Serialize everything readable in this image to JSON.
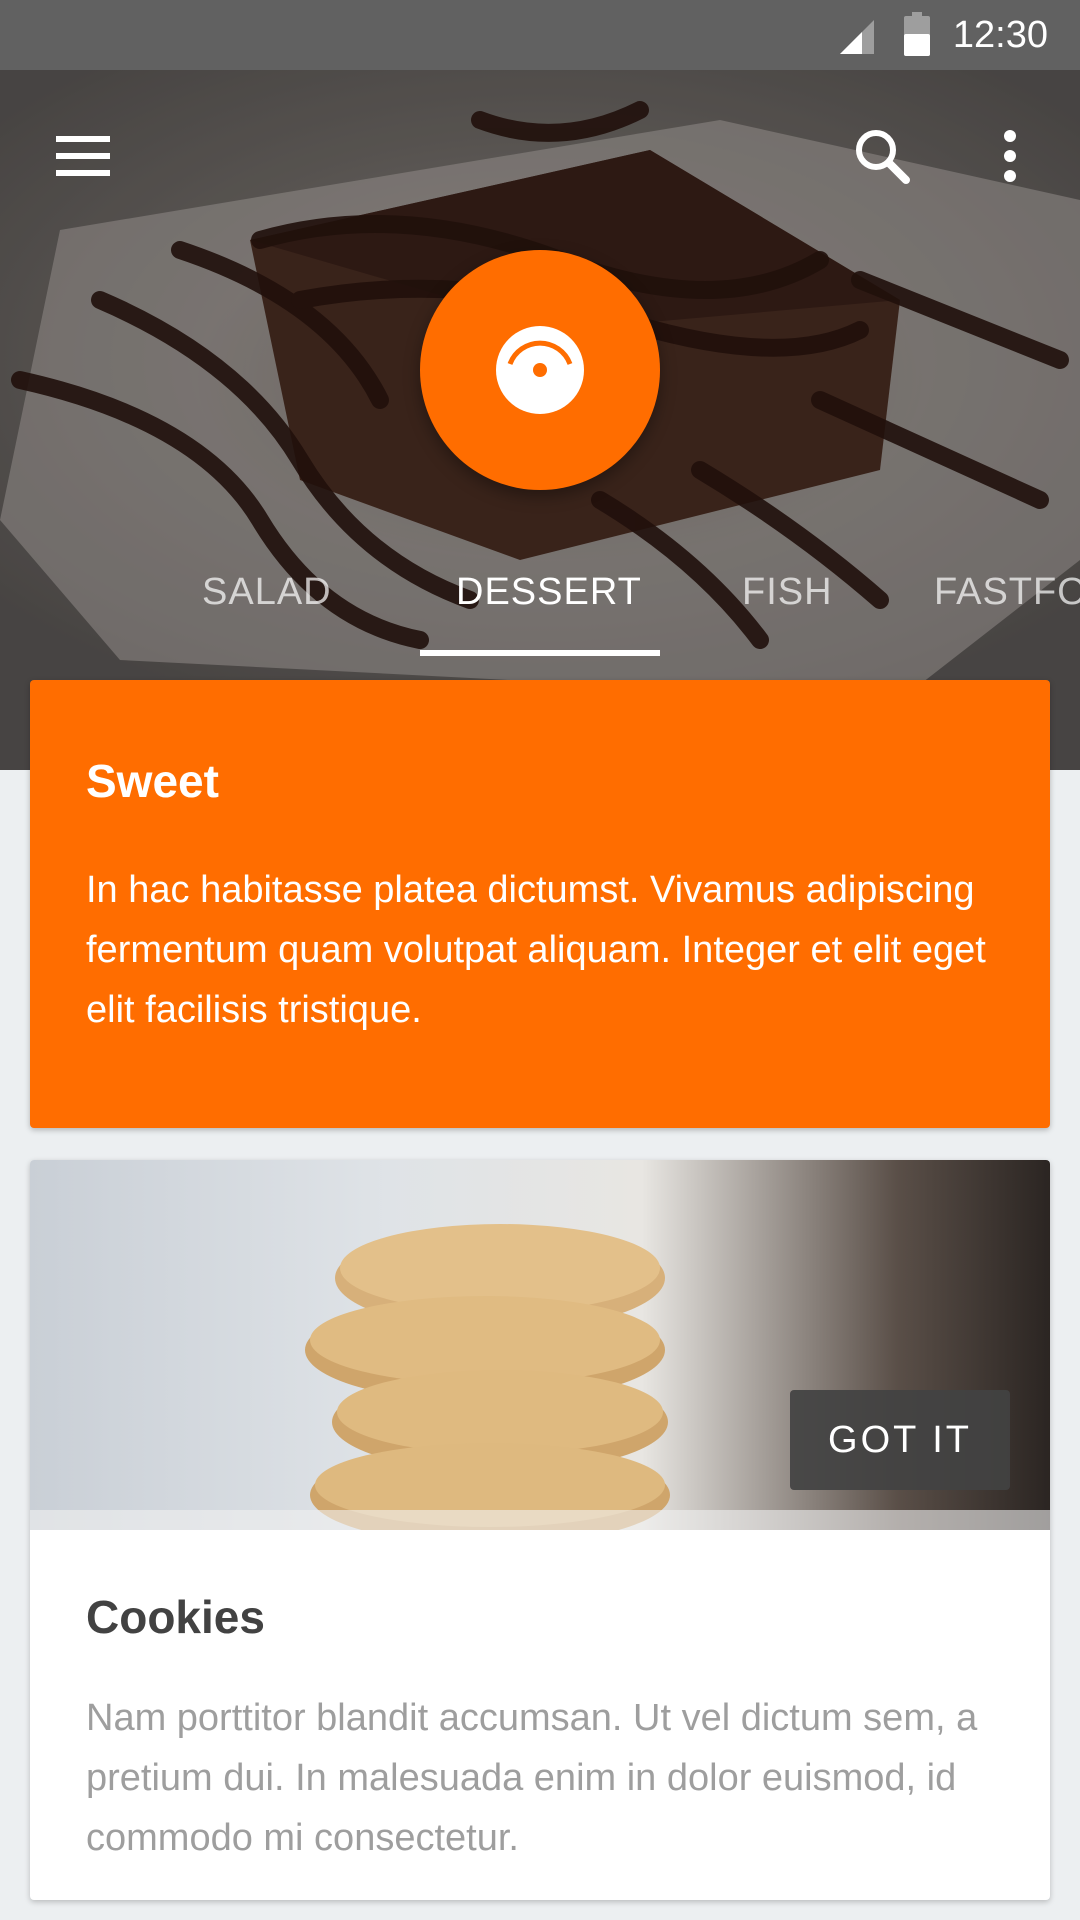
{
  "status_bar": {
    "time": "12:30"
  },
  "app_bar": {
    "menu_icon": "menu-icon",
    "search_icon": "search-icon",
    "more_icon": "more-vert-icon"
  },
  "tabs": [
    {
      "label": "SALAD",
      "active": false
    },
    {
      "label": "DESSERT",
      "active": true
    },
    {
      "label": "FISH",
      "active": false
    },
    {
      "label": "FASTFOOD",
      "active": false
    }
  ],
  "highlight_card": {
    "title": "Sweet",
    "body": "In hac habitasse platea dictumst. Vivamus adipiscing fermentum quam volutpat aliquam. Integer et elit eget elit facilisis tristique."
  },
  "media_card": {
    "action_label": "GOT IT",
    "title": "Cookies",
    "body": "Nam porttitor blandit accumsan. Ut vel dictum sem, a pretium dui. In malesuada enim in dolor euismod, id commodo mi consectetur."
  },
  "colors": {
    "accent": "#ff6d00",
    "status_bar": "#616161",
    "background": "#eceff1"
  }
}
